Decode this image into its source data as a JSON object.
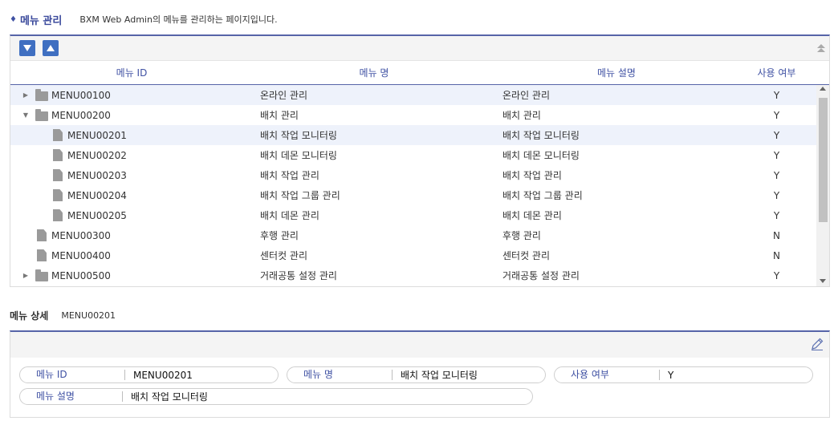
{
  "header": {
    "title": "메뉴 관리",
    "description": "BXM Web Admin의 메뉴를 관리하는 페이지입니다."
  },
  "grid": {
    "columns": [
      "메뉴 ID",
      "메뉴 명",
      "메뉴 설명",
      "사용 여부"
    ],
    "rows": [
      {
        "id": "MENU00100",
        "name": "온라인 관리",
        "desc": "온라인 관리",
        "use": "Y"
      },
      {
        "id": "MENU00200",
        "name": "배치 관리",
        "desc": "배치 관리",
        "use": "Y"
      },
      {
        "id": "MENU00201",
        "name": "배치 작업 모니터링",
        "desc": "배치 작업 모니터링",
        "use": "Y"
      },
      {
        "id": "MENU00202",
        "name": "배치 데몬 모니터링",
        "desc": "배치 데몬 모니터링",
        "use": "Y"
      },
      {
        "id": "MENU00203",
        "name": "배치 작업 관리",
        "desc": "배치 작업 관리",
        "use": "Y"
      },
      {
        "id": "MENU00204",
        "name": "배치 작업 그룹 관리",
        "desc": "배치 작업 그룹 관리",
        "use": "Y"
      },
      {
        "id": "MENU00205",
        "name": "배치 데몬 관리",
        "desc": "배치 데몬 관리",
        "use": "Y"
      },
      {
        "id": "MENU00300",
        "name": "후행 관리",
        "desc": "후행 관리",
        "use": "N"
      },
      {
        "id": "MENU00400",
        "name": "센터컷 관리",
        "desc": "센터컷 관리",
        "use": "N"
      },
      {
        "id": "MENU00500",
        "name": "거래공통 설정 관리",
        "desc": "거래공통 설정 관리",
        "use": "Y"
      }
    ]
  },
  "detail": {
    "title": "메뉴 상세",
    "selected_id": "MENU00201",
    "fields": {
      "menu_id": {
        "label": "메뉴 ID",
        "value": "MENU00201"
      },
      "menu_name": {
        "label": "메뉴 명",
        "value": "배치 작업 모니터링"
      },
      "use_yn": {
        "label": "사용 여부",
        "value": "Y"
      },
      "menu_desc": {
        "label": "메뉴 설명",
        "value": "배치 작업 모니터링"
      }
    }
  },
  "colors": {
    "accent": "#3f51a3",
    "button": "#3f6fc1",
    "row_highlight": "#eef2fb",
    "icon_gray": "#9a9a9a"
  },
  "icons": {
    "expand_all": "chevron-down-icon",
    "collapse_all": "chevron-up-icon",
    "folder": "folder-icon",
    "file": "file-icon",
    "edit": "pencil-icon"
  }
}
